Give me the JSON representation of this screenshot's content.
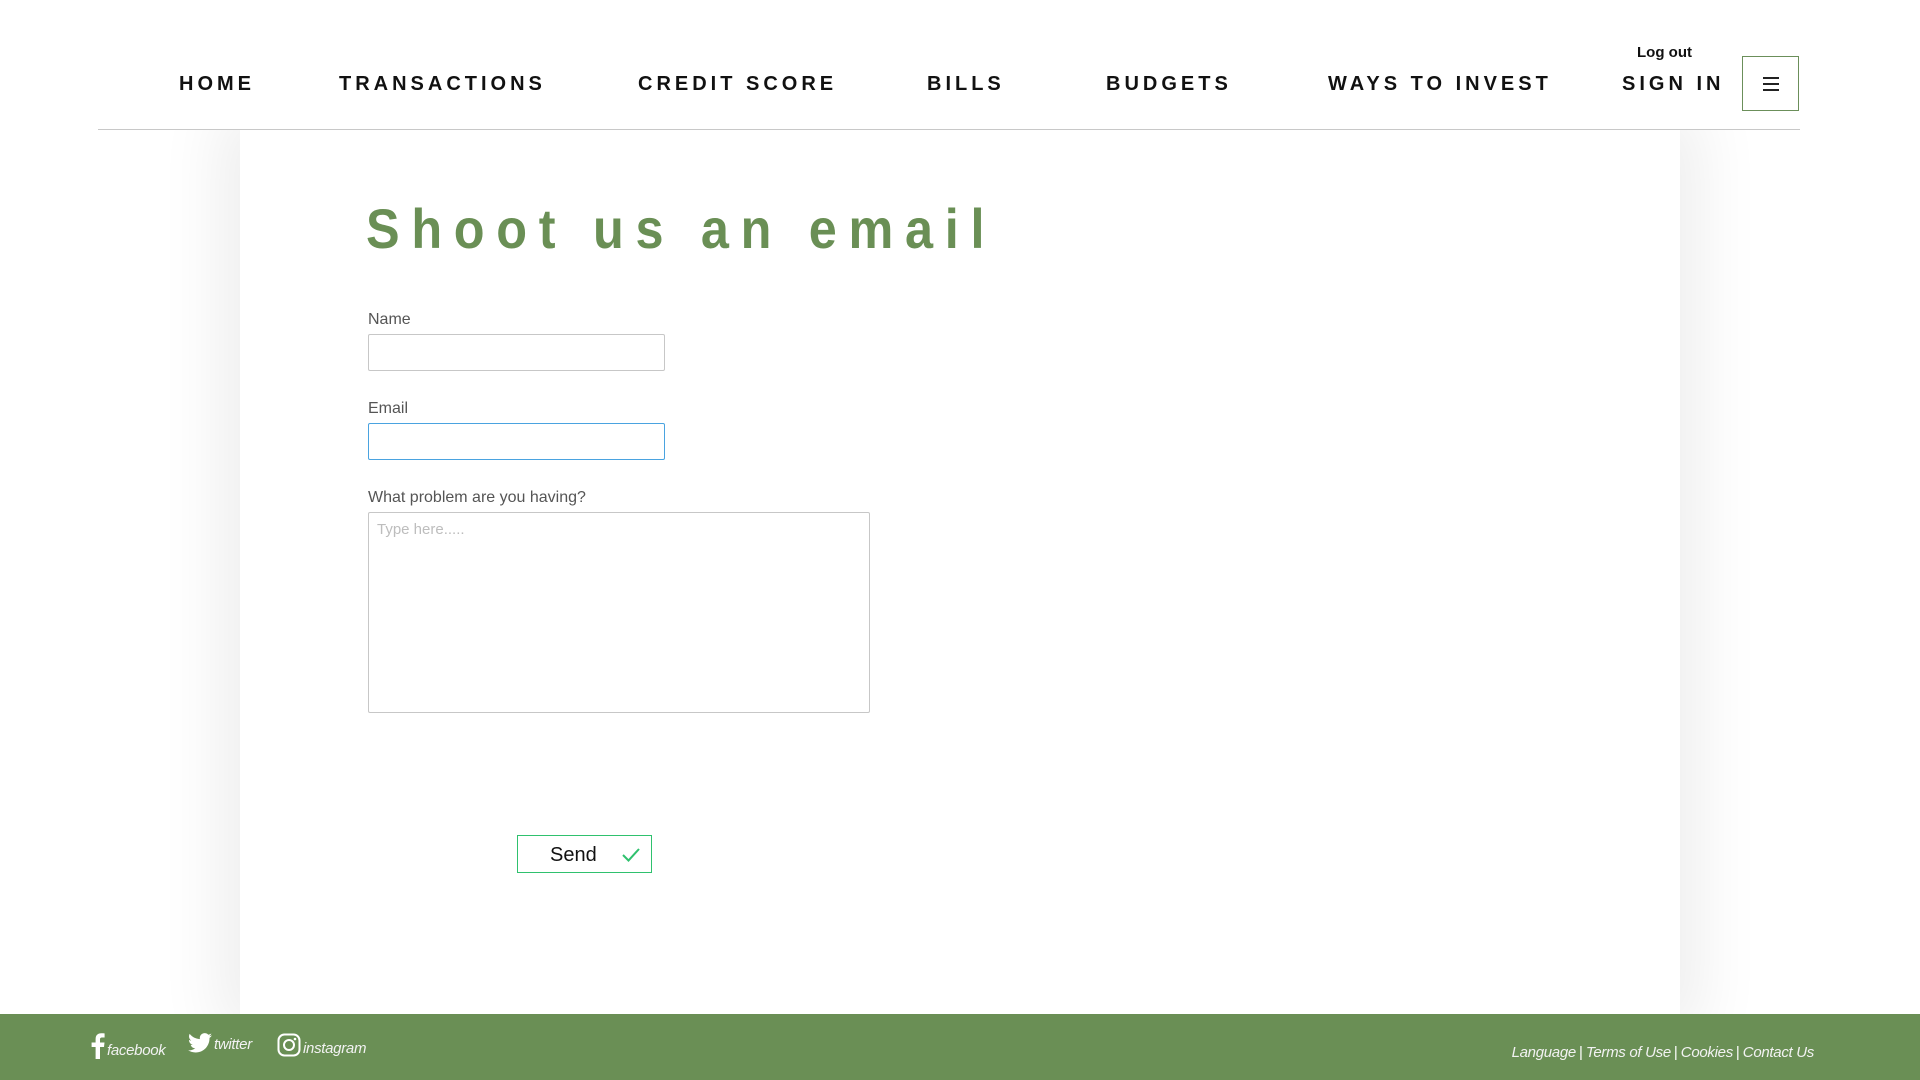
{
  "header": {
    "nav": [
      {
        "label": "HOME"
      },
      {
        "label": "TRANSACTIONS"
      },
      {
        "label": "CREDIT SCORE"
      },
      {
        "label": "BILLS"
      },
      {
        "label": "BUDGETS"
      },
      {
        "label": "WAYS TO INVEST"
      },
      {
        "label": "SIGN IN"
      }
    ],
    "logout_label": "Log out",
    "menu_icon": "hamburger-icon"
  },
  "form": {
    "title": "Shoot us an email",
    "name_label": "Name",
    "name_value": "",
    "email_label": "Email",
    "email_value": "",
    "problem_label": "What problem are you having?",
    "problem_placeholder": "Type here.....",
    "send_label": "Send",
    "send_icon": "check-icon"
  },
  "footer": {
    "social": [
      {
        "label": "facebook",
        "icon": "facebook-icon"
      },
      {
        "label": "twitter",
        "icon": "twitter-icon"
      },
      {
        "label": "instagram",
        "icon": "instagram-icon"
      }
    ],
    "links": [
      {
        "label": "Language"
      },
      {
        "label": "Terms of Use"
      },
      {
        "label": "Cookies"
      },
      {
        "label": "Contact Us"
      }
    ]
  },
  "colors": {
    "accent_green": "#6a8f55",
    "send_border": "#2fc16e",
    "focus_blue": "#4aa3e0"
  }
}
